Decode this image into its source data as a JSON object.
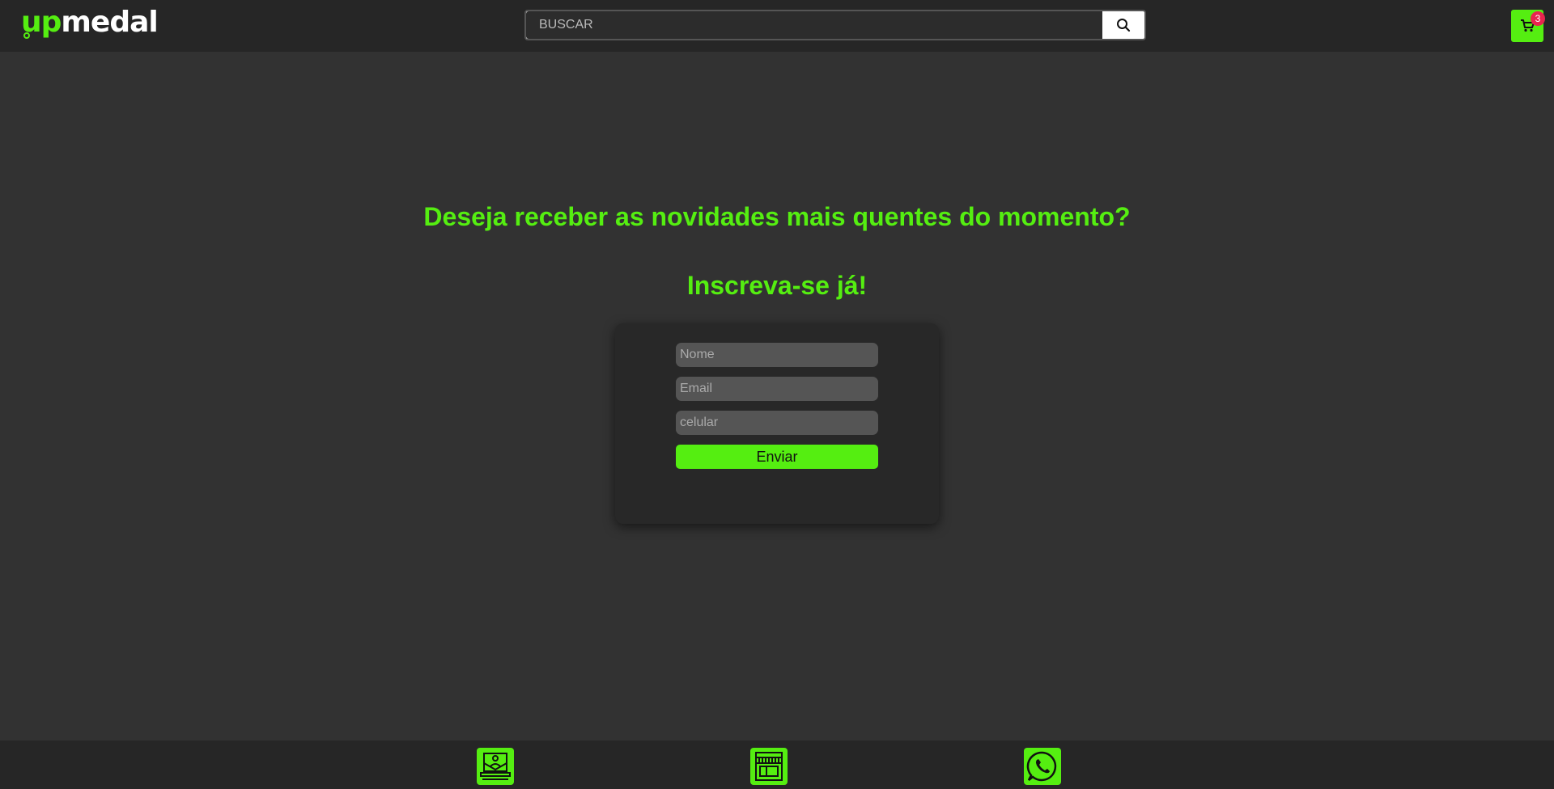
{
  "header": {
    "logo": {
      "part1": "up",
      "part2": "medal"
    },
    "search": {
      "placeholder": "BUSCAR",
      "icon": "search-icon"
    },
    "cart": {
      "icon": "cart-icon",
      "count": "3"
    }
  },
  "main": {
    "headline": "Deseja receber as novidades mais quentes do momento?",
    "subheadline": "Inscreva-se já!",
    "form": {
      "name_placeholder": "Nome",
      "email_placeholder": "Email",
      "phone_placeholder": "celular",
      "submit_label": "Enviar"
    }
  },
  "footer": {
    "items": [
      {
        "icon": "laptop-store-icon"
      },
      {
        "icon": "storefront-icon"
      },
      {
        "icon": "whatsapp-icon"
      }
    ]
  },
  "colors": {
    "accent": "#55ee11",
    "background": "#323232",
    "bar": "#262626",
    "badge": "#e8254f"
  }
}
